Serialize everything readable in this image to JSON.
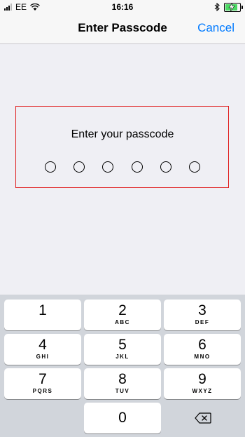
{
  "status_bar": {
    "carrier": "EE",
    "time": "16:16",
    "battery_level": 0.85,
    "icons": [
      "signal-icon",
      "wifi-icon",
      "bluetooth-icon",
      "battery-icon"
    ]
  },
  "nav": {
    "title": "Enter Passcode",
    "cancel_label": "Cancel"
  },
  "passcode": {
    "prompt": "Enter your passcode",
    "length": 6,
    "entered": 0
  },
  "keypad": {
    "keys": [
      {
        "digit": "1",
        "letters": ""
      },
      {
        "digit": "2",
        "letters": "ABC"
      },
      {
        "digit": "3",
        "letters": "DEF"
      },
      {
        "digit": "4",
        "letters": "GHI"
      },
      {
        "digit": "5",
        "letters": "JKL"
      },
      {
        "digit": "6",
        "letters": "MNO"
      },
      {
        "digit": "7",
        "letters": "PQRS"
      },
      {
        "digit": "8",
        "letters": "TUV"
      },
      {
        "digit": "9",
        "letters": "WXYZ"
      },
      {
        "digit": "0",
        "letters": ""
      }
    ],
    "delete_icon": "backspace-icon"
  },
  "colors": {
    "accent": "#007aff",
    "highlight_border": "#e02020",
    "battery": "#4cd964"
  }
}
